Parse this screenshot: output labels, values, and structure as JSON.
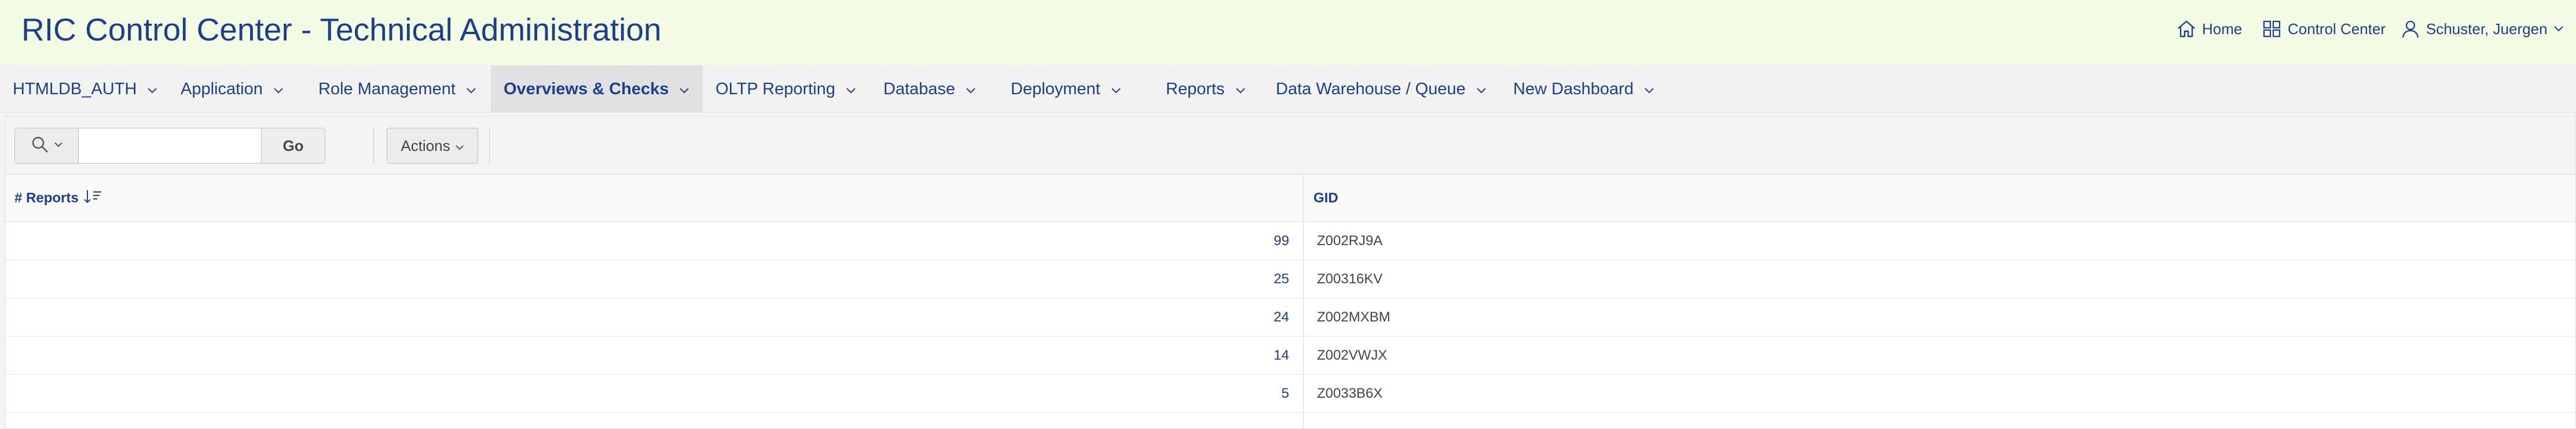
{
  "app": {
    "title": "RIC Control Center - Technical Administration"
  },
  "header": {
    "home_label": "Home",
    "control_center_label": "Control Center",
    "user_label": "Schuster, Juergen"
  },
  "nav": {
    "items": [
      {
        "label": "HTMLDB_AUTH",
        "active": false
      },
      {
        "label": "Application",
        "active": false
      },
      {
        "label": "Role Management",
        "active": false
      },
      {
        "label": "Overviews & Checks",
        "active": true
      },
      {
        "label": "OLTP Reporting",
        "active": false
      },
      {
        "label": "Database",
        "active": false
      },
      {
        "label": "Deployment",
        "active": false
      },
      {
        "label": "Reports",
        "active": false
      },
      {
        "label": "Data Warehouse / Queue",
        "active": false
      },
      {
        "label": "New Dashboard",
        "active": false
      }
    ]
  },
  "toolbar": {
    "search_value": "",
    "go_label": "Go",
    "actions_label": "Actions"
  },
  "table": {
    "columns": [
      "# Reports",
      "GID"
    ],
    "rows": [
      {
        "count": "99",
        "gid": "Z002RJ9A"
      },
      {
        "count": "25",
        "gid": "Z00316KV"
      },
      {
        "count": "24",
        "gid": "Z002MXBM"
      },
      {
        "count": "14",
        "gid": "Z002VWJX"
      },
      {
        "count": "5",
        "gid": "Z0033B6X"
      }
    ]
  },
  "colors": {
    "header_bg": "#f3fbe4",
    "accent": "#1b3f8a",
    "active_tab_bg": "#e1e1e1"
  },
  "icons": [
    "home-icon",
    "grid-icon",
    "user-icon",
    "chevron-down-icon",
    "search-icon",
    "sort-descending-icon"
  ]
}
